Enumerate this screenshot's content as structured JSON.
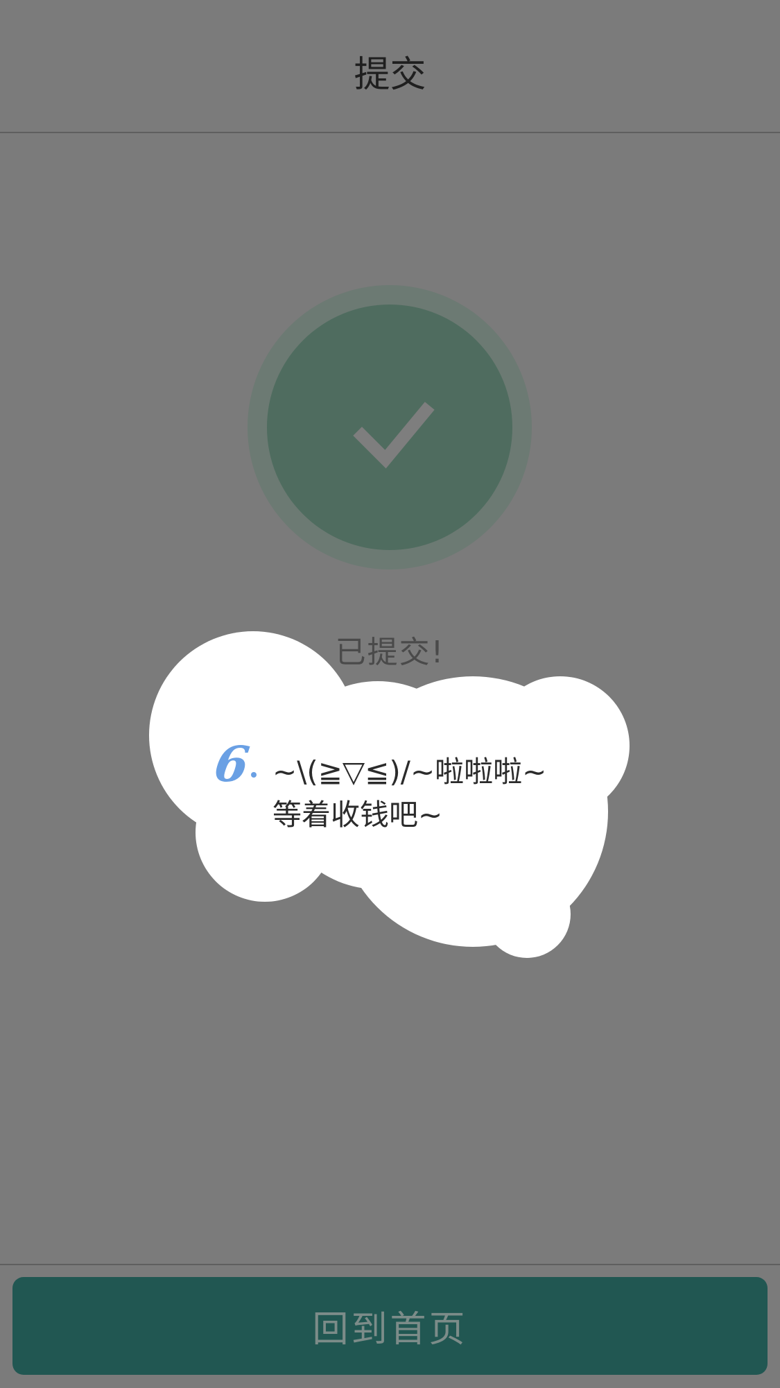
{
  "header": {
    "title": "提交"
  },
  "status": {
    "icon": "check-icon",
    "message": "已提交!"
  },
  "toast": {
    "number": "6",
    "text": "~\\(≧▽≦)/~啦啦啦~\n等着收钱吧~"
  },
  "footer": {
    "home_button_label": "回到首页"
  },
  "colors": {
    "overlay": "#7b7b7b",
    "success_green": "#4f6c5f",
    "button": "#215752",
    "accent_blue": "#6aa0e4"
  }
}
